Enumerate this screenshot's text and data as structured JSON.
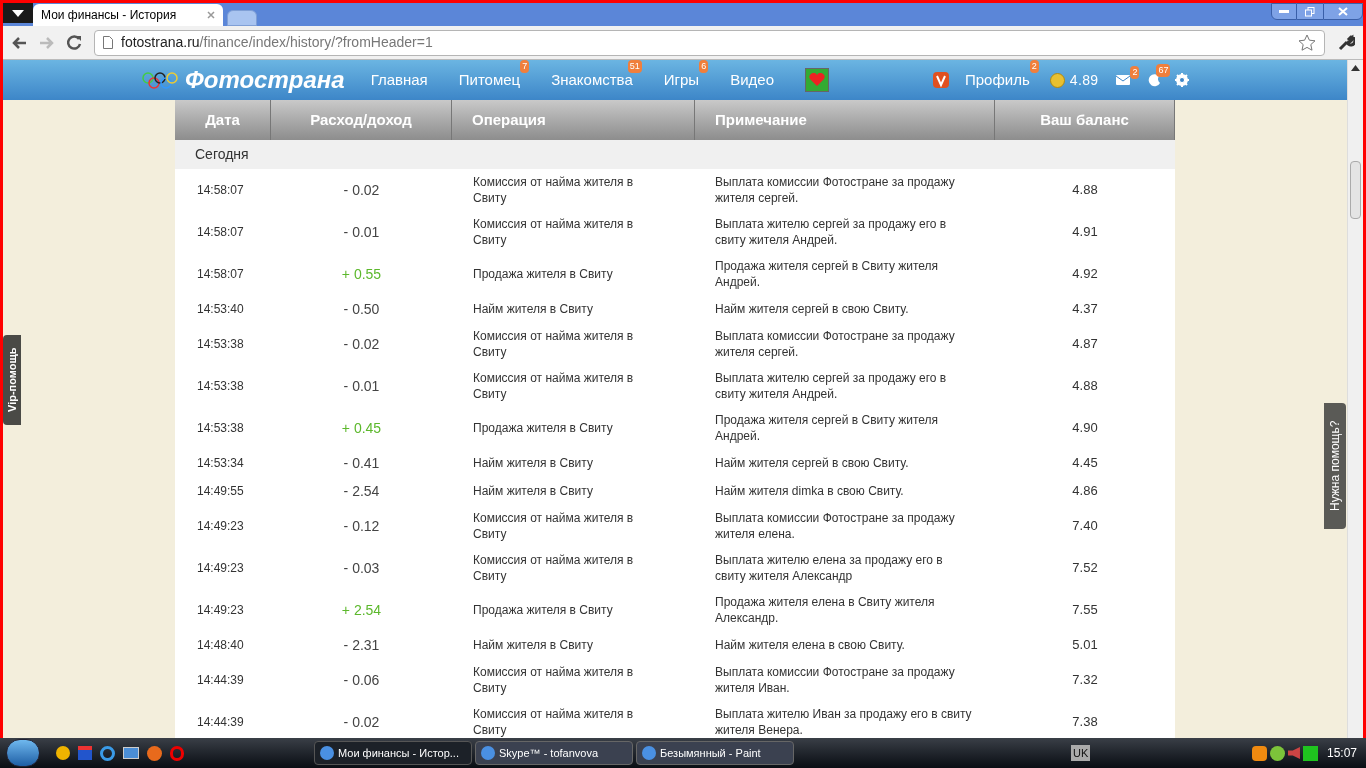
{
  "browser": {
    "tab_title": "Мои финансы - История",
    "url_host": "fotostrana.ru",
    "url_path": "/finance/index/history/?fromHeader=1"
  },
  "site_nav": {
    "logo": "Фотострана",
    "items": [
      {
        "label": "Главная"
      },
      {
        "label": "Питомец",
        "badge": "7"
      },
      {
        "label": "Знакомства",
        "badge": "51"
      },
      {
        "label": "Игры",
        "badge": "6"
      },
      {
        "label": "Видео"
      }
    ],
    "profile": {
      "label": "Профиль",
      "badge": "2"
    },
    "balance": "4.89",
    "mail_badge": "2",
    "events_badge": "67"
  },
  "table": {
    "columns": [
      "Дата",
      "Расход/доход",
      "Операция",
      "Примечание",
      "Ваш баланс"
    ],
    "group": "Сегодня",
    "rows": [
      {
        "time": "14:58:07",
        "amount": "- 0.02",
        "kind": "expense",
        "operation": "Комиссия от найма жителя в Свиту",
        "note": "Выплата комиссии Фотостране за продажу жителя сергей.",
        "balance": "4.88"
      },
      {
        "time": "14:58:07",
        "amount": "- 0.01",
        "kind": "expense",
        "operation": "Комиссия от найма жителя в Свиту",
        "note": "Выплата жителю сергей за продажу его в свиту жителя Андрей.",
        "balance": "4.91"
      },
      {
        "time": "14:58:07",
        "amount": "+ 0.55",
        "kind": "income",
        "operation": "Продажа жителя в Свиту",
        "note": "Продажа жителя сергей в Свиту жителя Андрей.",
        "balance": "4.92"
      },
      {
        "time": "14:53:40",
        "amount": "- 0.50",
        "kind": "expense",
        "operation": "Найм жителя в Свиту",
        "note": "Найм жителя сергей в свою Свиту.",
        "balance": "4.37"
      },
      {
        "time": "14:53:38",
        "amount": "- 0.02",
        "kind": "expense",
        "operation": "Комиссия от найма жителя в Свиту",
        "note": "Выплата комиссии Фотостране за продажу жителя сергей.",
        "balance": "4.87"
      },
      {
        "time": "14:53:38",
        "amount": "- 0.01",
        "kind": "expense",
        "operation": "Комиссия от найма жителя в Свиту",
        "note": "Выплата жителю сергей за продажу его в свиту жителя Андрей.",
        "balance": "4.88"
      },
      {
        "time": "14:53:38",
        "amount": "+ 0.45",
        "kind": "income",
        "operation": "Продажа жителя в Свиту",
        "note": "Продажа жителя сергей в Свиту жителя Андрей.",
        "balance": "4.90"
      },
      {
        "time": "14:53:34",
        "amount": "- 0.41",
        "kind": "expense",
        "operation": "Найм жителя в Свиту",
        "note": "Найм жителя сергей в свою Свиту.",
        "balance": "4.45"
      },
      {
        "time": "14:49:55",
        "amount": "- 2.54",
        "kind": "expense",
        "operation": "Найм жителя в Свиту",
        "note": "Найм жителя dimka в свою Свиту.",
        "balance": "4.86"
      },
      {
        "time": "14:49:23",
        "amount": "- 0.12",
        "kind": "expense",
        "operation": "Комиссия от найма жителя в Свиту",
        "note": "Выплата комиссии Фотостране за продажу жителя елена.",
        "balance": "7.40"
      },
      {
        "time": "14:49:23",
        "amount": "- 0.03",
        "kind": "expense",
        "operation": "Комиссия от найма жителя в Свиту",
        "note": "Выплата жителю елена за продажу его в свиту жителя Александр",
        "balance": "7.52"
      },
      {
        "time": "14:49:23",
        "amount": "+ 2.54",
        "kind": "income",
        "operation": "Продажа жителя в Свиту",
        "note": "Продажа жителя елена в Свиту жителя Александр.",
        "balance": "7.55"
      },
      {
        "time": "14:48:40",
        "amount": "- 2.31",
        "kind": "expense",
        "operation": "Найм жителя в Свиту",
        "note": "Найм жителя елена в свою Свиту.",
        "balance": "5.01"
      },
      {
        "time": "14:44:39",
        "amount": "- 0.06",
        "kind": "expense",
        "operation": "Комиссия от найма жителя в Свиту",
        "note": "Выплата комиссии Фотостране за продажу жителя Иван.",
        "balance": "7.32"
      },
      {
        "time": "14:44:39",
        "amount": "- 0.02",
        "kind": "expense",
        "operation": "Комиссия от найма жителя в Свиту",
        "note": "Выплата жителю Иван за продажу его в свиту жителя Венера.",
        "balance": "7.38"
      }
    ]
  },
  "side_tabs": {
    "left": "Vip-помощь",
    "right": "Нужна помощь?"
  },
  "taskbar": {
    "tasks": [
      {
        "label": "Мои финансы - Истор...",
        "selected": true
      },
      {
        "label": "Skype™ - tofanvova",
        "selected": false
      },
      {
        "label": "Безымянный - Paint",
        "selected": false
      }
    ],
    "language": "UK",
    "clock": "15:07"
  }
}
